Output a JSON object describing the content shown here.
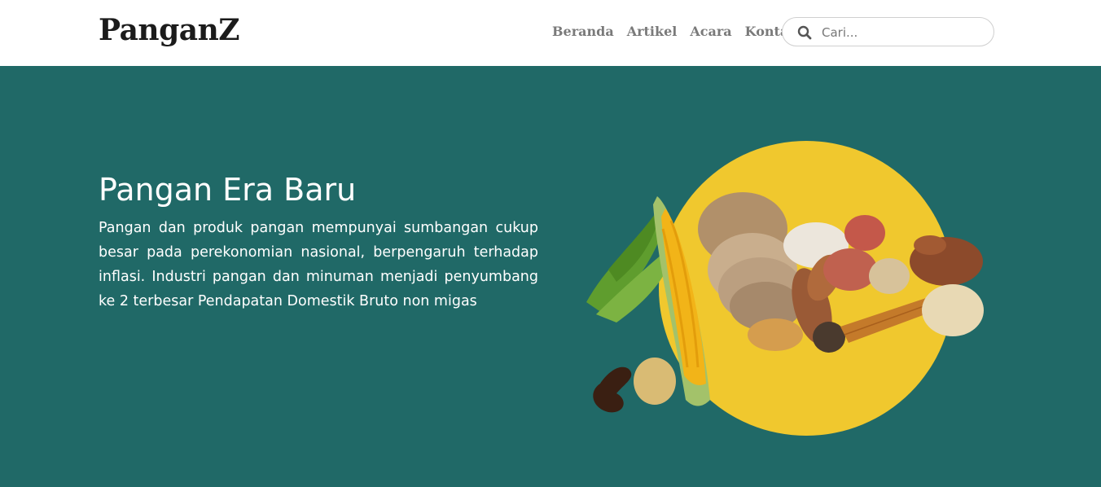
{
  "brand": {
    "name": "PanganZ"
  },
  "nav": {
    "items": [
      {
        "label": "Beranda"
      },
      {
        "label": "Artikel"
      },
      {
        "label": "Acara"
      },
      {
        "label": "Kontak"
      }
    ]
  },
  "search": {
    "placeholder": "Cari...",
    "value": "",
    "icon": "search-icon"
  },
  "hero": {
    "title": "Pangan Era Baru",
    "text": "Pangan dan produk pangan mempunyai sumbangan cukup besar pada perekonomian nasional, berpengaruh terhadap inflasi. Industri pangan dan minuman menjadi penyumbang ke 2 terbesar Pendapatan Domestik Bruto non migas"
  },
  "colors": {
    "hero_background": "#206967",
    "circle": "#F0C82E",
    "nav_text": "#7a7a7a",
    "brand_text": "#1b1b1b"
  }
}
